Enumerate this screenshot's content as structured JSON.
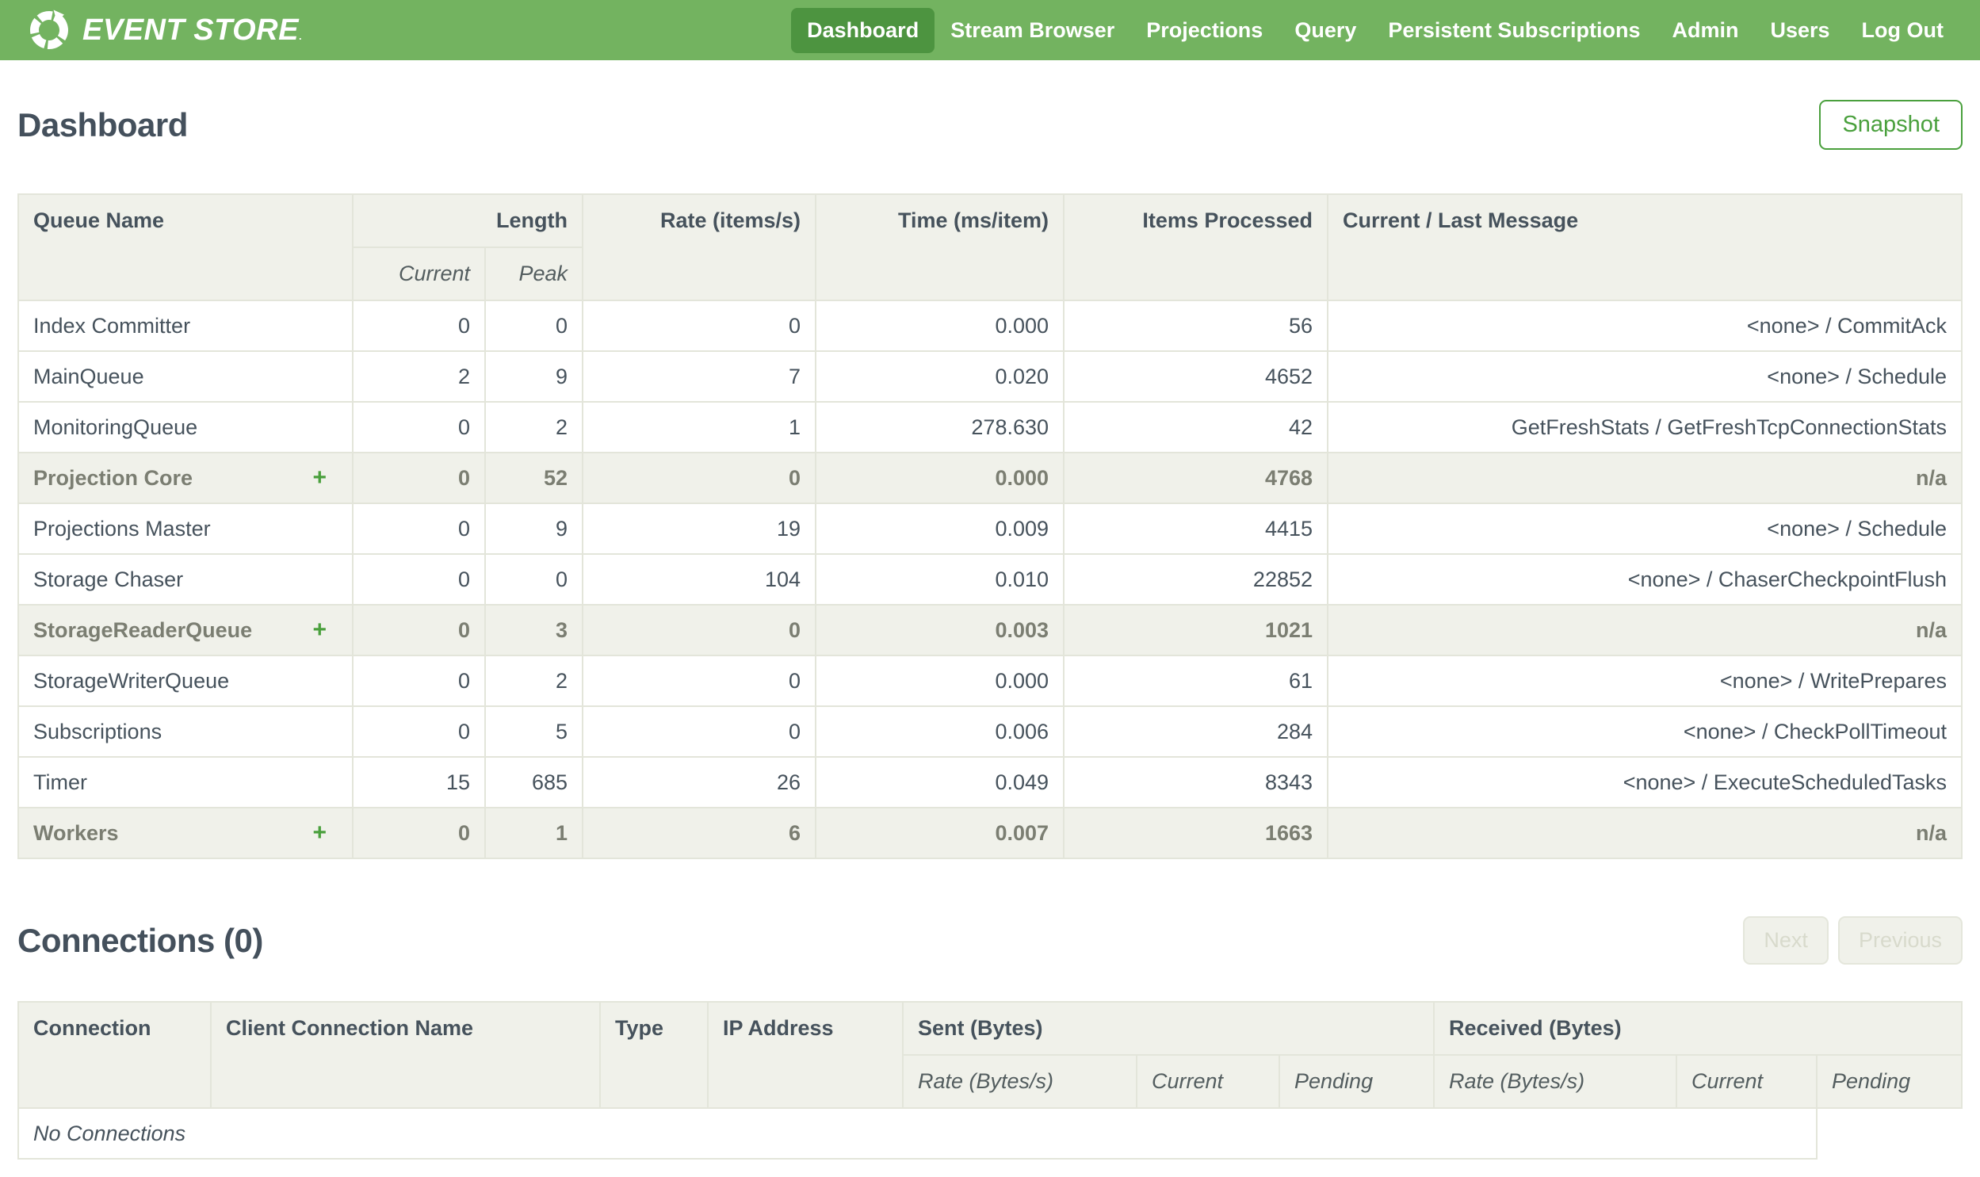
{
  "nav": {
    "brand": "EVENT STORE",
    "brand_mark": ".",
    "items": [
      {
        "label": "Dashboard",
        "active": true
      },
      {
        "label": "Stream Browser",
        "active": false
      },
      {
        "label": "Projections",
        "active": false
      },
      {
        "label": "Query",
        "active": false
      },
      {
        "label": "Persistent Subscriptions",
        "active": false
      },
      {
        "label": "Admin",
        "active": false
      },
      {
        "label": "Users",
        "active": false
      },
      {
        "label": "Log Out",
        "active": false
      }
    ]
  },
  "page": {
    "title": "Dashboard",
    "snapshot_button": "Snapshot"
  },
  "queues": {
    "expand_glyph": "+",
    "headers": {
      "queue_name": "Queue Name",
      "length": "Length",
      "current": "Current",
      "peak": "Peak",
      "rate": "Rate (items/s)",
      "time": "Time (ms/item)",
      "items_processed": "Items Processed",
      "message": "Current / Last Message"
    },
    "rows": [
      {
        "name": "Index Committer",
        "group": false,
        "current": "0",
        "peak": "0",
        "rate": "0",
        "time": "0.000",
        "items": "56",
        "message": "<none> / CommitAck"
      },
      {
        "name": "MainQueue",
        "group": false,
        "current": "2",
        "peak": "9",
        "rate": "7",
        "time": "0.020",
        "items": "4652",
        "message": "<none> / Schedule"
      },
      {
        "name": "MonitoringQueue",
        "group": false,
        "current": "0",
        "peak": "2",
        "rate": "1",
        "time": "278.630",
        "items": "42",
        "message": "GetFreshStats / GetFreshTcpConnectionStats"
      },
      {
        "name": "Projection Core",
        "group": true,
        "current": "0",
        "peak": "52",
        "rate": "0",
        "time": "0.000",
        "items": "4768",
        "message": "n/a"
      },
      {
        "name": "Projections Master",
        "group": false,
        "current": "0",
        "peak": "9",
        "rate": "19",
        "time": "0.009",
        "items": "4415",
        "message": "<none> / Schedule"
      },
      {
        "name": "Storage Chaser",
        "group": false,
        "current": "0",
        "peak": "0",
        "rate": "104",
        "time": "0.010",
        "items": "22852",
        "message": "<none> / ChaserCheckpointFlush"
      },
      {
        "name": "StorageReaderQueue",
        "group": true,
        "current": "0",
        "peak": "3",
        "rate": "0",
        "time": "0.003",
        "items": "1021",
        "message": "n/a"
      },
      {
        "name": "StorageWriterQueue",
        "group": false,
        "current": "0",
        "peak": "2",
        "rate": "0",
        "time": "0.000",
        "items": "61",
        "message": "<none> / WritePrepares"
      },
      {
        "name": "Subscriptions",
        "group": false,
        "current": "0",
        "peak": "5",
        "rate": "0",
        "time": "0.006",
        "items": "284",
        "message": "<none> / CheckPollTimeout"
      },
      {
        "name": "Timer",
        "group": false,
        "current": "15",
        "peak": "685",
        "rate": "26",
        "time": "0.049",
        "items": "8343",
        "message": "<none> / ExecuteScheduledTasks"
      },
      {
        "name": "Workers",
        "group": true,
        "current": "0",
        "peak": "1",
        "rate": "6",
        "time": "0.007",
        "items": "1663",
        "message": "n/a"
      }
    ]
  },
  "connections": {
    "title": "Connections (0)",
    "next_button": "Next",
    "previous_button": "Previous",
    "headers": {
      "connection": "Connection",
      "client_name": "Client Connection Name",
      "type": "Type",
      "ip": "IP Address",
      "sent": "Sent (Bytes)",
      "received": "Received (Bytes)",
      "rate": "Rate (Bytes/s)",
      "current": "Current",
      "pending": "Pending"
    },
    "empty_message": "No Connections"
  },
  "colors": {
    "green": "#73b360",
    "green_dark": "#4d9440",
    "green_accent": "#4aa03d",
    "slate": "#46525c",
    "header_bg": "#f0f1ea",
    "border": "#e3e5da",
    "group_text": "#7b7e72",
    "disabled_text": "#d8dacc"
  }
}
